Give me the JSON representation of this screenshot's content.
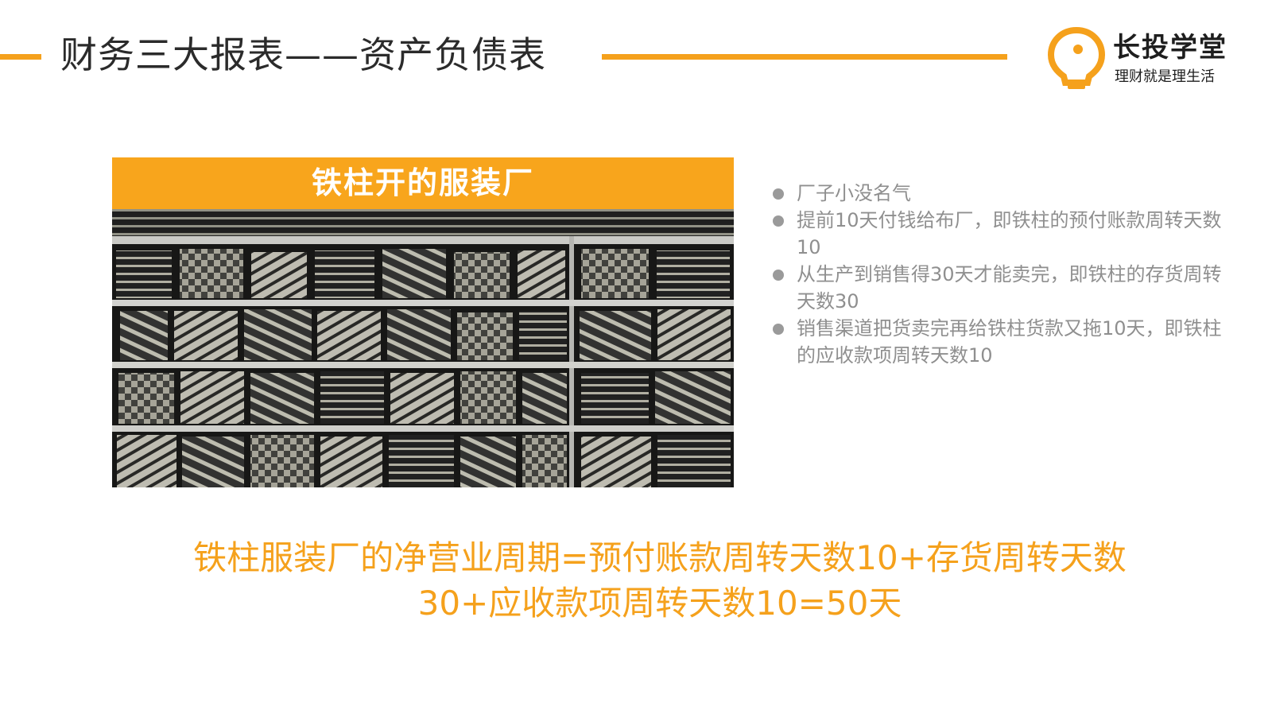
{
  "header": {
    "title": "财务三大报表——资产负债表",
    "accent_color": "#f5a11c"
  },
  "logo": {
    "name": "长投学堂",
    "slogan": "理财就是理生活",
    "icon": "lightbulb-icon"
  },
  "card": {
    "banner": "铁柱开的服装厂",
    "banner_color": "#f8a51c",
    "image": "folded-clothes-shelf-photo"
  },
  "bullets": [
    {
      "text": "厂子小没名气"
    },
    {
      "text": "提前10天付钱给布厂，即铁柱的预付账款周转天数10"
    },
    {
      "text": "从生产到销售得30天才能卖完，即铁柱的存货周转天数30"
    },
    {
      "text": "销售渠道把货卖完再给铁柱货款又拖10天，即铁柱的应收款项周转天数10"
    }
  ],
  "summary": {
    "line1": "铁柱服装厂的净营业周期=预付账款周转天数10+存货周转天数",
    "line2": "30+应收款项周转天数10=50天"
  }
}
